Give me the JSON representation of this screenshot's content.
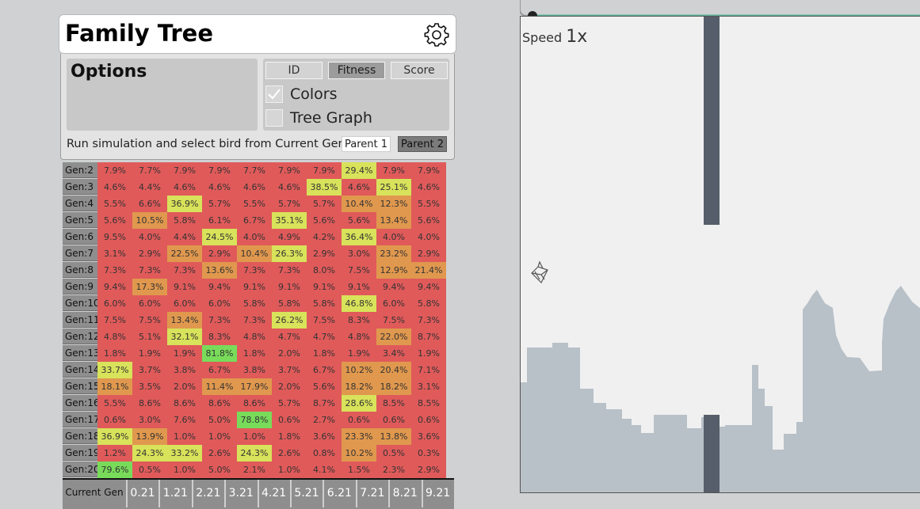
{
  "panel": {
    "title": "Family Tree"
  },
  "options": {
    "title": "Options",
    "sort_buttons": [
      {
        "label": "ID",
        "active": false
      },
      {
        "label": "Fitness",
        "active": true
      },
      {
        "label": "Score",
        "active": false
      }
    ],
    "checkboxes": [
      {
        "label": "Colors",
        "checked": true
      },
      {
        "label": "Tree Graph",
        "checked": false
      }
    ],
    "instruction": "Run simulation and select bird from Current Gen",
    "parent1": "Parent 1",
    "parent2": "Parent 2"
  },
  "grid": {
    "rows": [
      {
        "label": "Gen:2",
        "values": [
          "7.9%",
          "7.7%",
          "7.9%",
          "7.9%",
          "7.7%",
          "7.9%",
          "7.9%",
          "29.4%",
          "7.9%",
          "7.9%"
        ]
      },
      {
        "label": "Gen:3",
        "values": [
          "4.6%",
          "4.4%",
          "4.6%",
          "4.6%",
          "4.6%",
          "4.6%",
          "38.5%",
          "4.6%",
          "25.1%",
          "4.6%"
        ]
      },
      {
        "label": "Gen:4",
        "values": [
          "5.5%",
          "6.6%",
          "36.9%",
          "5.7%",
          "5.5%",
          "5.7%",
          "5.7%",
          "10.4%",
          "12.3%",
          "5.5%"
        ]
      },
      {
        "label": "Gen:5",
        "values": [
          "5.6%",
          "10.5%",
          "5.8%",
          "6.1%",
          "6.7%",
          "35.1%",
          "5.6%",
          "5.6%",
          "13.4%",
          "5.6%"
        ]
      },
      {
        "label": "Gen:6",
        "values": [
          "9.5%",
          "4.0%",
          "4.4%",
          "24.5%",
          "4.0%",
          "4.9%",
          "4.2%",
          "36.4%",
          "4.0%",
          "4.0%"
        ]
      },
      {
        "label": "Gen:7",
        "values": [
          "3.1%",
          "2.9%",
          "22.5%",
          "2.9%",
          "10.4%",
          "26.3%",
          "2.9%",
          "3.0%",
          "23.2%",
          "2.9%"
        ]
      },
      {
        "label": "Gen:8",
        "values": [
          "7.3%",
          "7.3%",
          "7.3%",
          "13.6%",
          "7.3%",
          "7.3%",
          "8.0%",
          "7.5%",
          "12.9%",
          "21.4%"
        ]
      },
      {
        "label": "Gen:9",
        "values": [
          "9.4%",
          "17.3%",
          "9.1%",
          "9.4%",
          "9.1%",
          "9.1%",
          "9.1%",
          "9.1%",
          "9.4%",
          "9.4%"
        ]
      },
      {
        "label": "Gen:10",
        "values": [
          "6.0%",
          "6.0%",
          "6.0%",
          "6.0%",
          "5.8%",
          "5.8%",
          "5.8%",
          "46.8%",
          "6.0%",
          "5.8%"
        ]
      },
      {
        "label": "Gen:11",
        "values": [
          "7.5%",
          "7.5%",
          "13.4%",
          "7.3%",
          "7.3%",
          "26.2%",
          "7.5%",
          "8.3%",
          "7.5%",
          "7.3%"
        ]
      },
      {
        "label": "Gen:12",
        "values": [
          "4.8%",
          "5.1%",
          "32.1%",
          "8.3%",
          "4.8%",
          "4.7%",
          "4.7%",
          "4.8%",
          "22.0%",
          "8.7%"
        ]
      },
      {
        "label": "Gen:13",
        "values": [
          "1.8%",
          "1.9%",
          "1.9%",
          "81.8%",
          "1.8%",
          "2.0%",
          "1.8%",
          "1.9%",
          "3.4%",
          "1.9%"
        ]
      },
      {
        "label": "Gen:14",
        "values": [
          "33.7%",
          "3.7%",
          "3.8%",
          "6.7%",
          "3.8%",
          "3.7%",
          "6.7%",
          "10.2%",
          "20.4%",
          "7.1%"
        ]
      },
      {
        "label": "Gen:15",
        "values": [
          "18.1%",
          "3.5%",
          "2.0%",
          "11.4%",
          "17.9%",
          "2.0%",
          "5.6%",
          "18.2%",
          "18.2%",
          "3.1%"
        ]
      },
      {
        "label": "Gen:16",
        "values": [
          "5.5%",
          "8.6%",
          "8.6%",
          "8.6%",
          "8.6%",
          "5.7%",
          "8.7%",
          "28.6%",
          "8.5%",
          "8.5%"
        ]
      },
      {
        "label": "Gen:17",
        "values": [
          "0.6%",
          "3.0%",
          "7.6%",
          "5.0%",
          "78.8%",
          "0.6%",
          "2.7%",
          "0.6%",
          "0.6%",
          "0.6%"
        ]
      },
      {
        "label": "Gen:18",
        "values": [
          "36.9%",
          "13.9%",
          "1.0%",
          "1.0%",
          "1.0%",
          "1.8%",
          "3.6%",
          "23.3%",
          "13.8%",
          "3.6%"
        ]
      },
      {
        "label": "Gen:19",
        "values": [
          "1.2%",
          "24.3%",
          "33.2%",
          "2.6%",
          "24.3%",
          "2.6%",
          "0.8%",
          "10.2%",
          "0.5%",
          "0.3%"
        ]
      },
      {
        "label": "Gen:20",
        "values": [
          "79.6%",
          "0.5%",
          "1.0%",
          "5.0%",
          "2.1%",
          "1.0%",
          "4.1%",
          "1.5%",
          "2.3%",
          "2.9%"
        ]
      }
    ],
    "current_gen_label": "Current Gen",
    "current_gen": [
      "0.21",
      "1.21",
      "2.21",
      "3.21",
      "4.21",
      "5.21",
      "6.21",
      "7.21",
      "8.21",
      "9.21"
    ]
  },
  "game": {
    "speed_label": "Speed",
    "speed_value": "1x"
  },
  "colors": {
    "cell_red": "#e05a5a",
    "cell_orange": "#e0984e",
    "cell_yellow": "#d8e25a",
    "cell_green": "#78dc5a",
    "accent_teal": "#5aaf92",
    "pipe": "#555e6a",
    "skyline": "#b8c0c8"
  }
}
